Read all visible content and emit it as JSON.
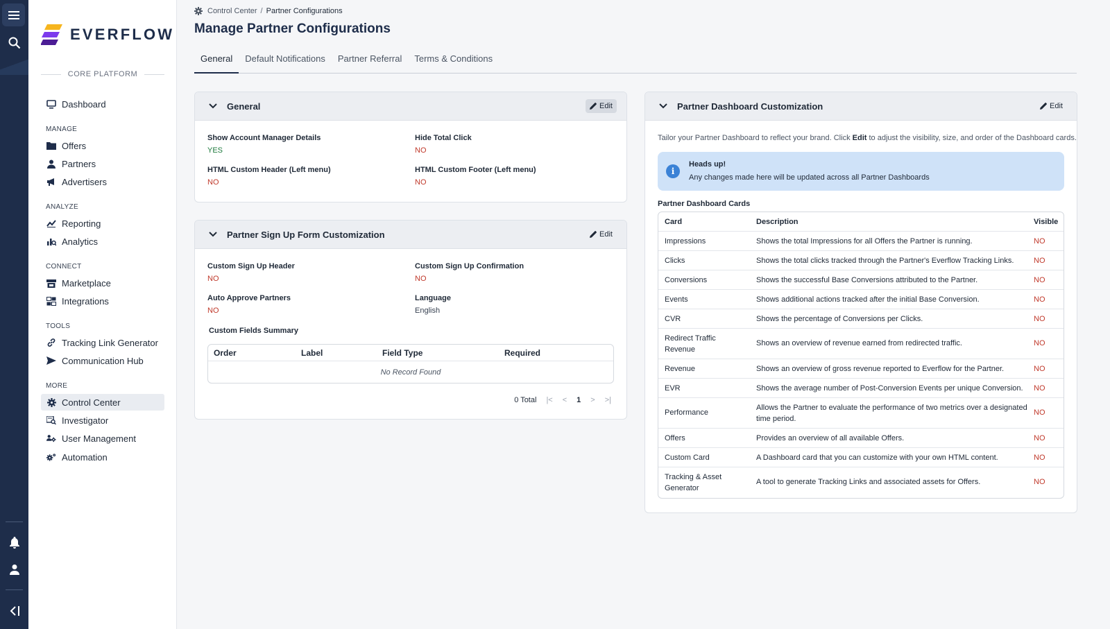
{
  "brand": {
    "name": "EVERFLOW",
    "platform": "CORE PLATFORM"
  },
  "nav": {
    "dashboard": "Dashboard",
    "sections": [
      {
        "title": "MANAGE",
        "items": [
          "Offers",
          "Partners",
          "Advertisers"
        ]
      },
      {
        "title": "ANALYZE",
        "items": [
          "Reporting",
          "Analytics"
        ]
      },
      {
        "title": "CONNECT",
        "items": [
          "Marketplace",
          "Integrations"
        ]
      },
      {
        "title": "TOOLS",
        "items": [
          "Tracking Link Generator",
          "Communication Hub"
        ]
      },
      {
        "title": "MORE",
        "items": [
          "Control Center",
          "Investigator",
          "User Management",
          "Automation"
        ]
      }
    ],
    "active": "Control Center"
  },
  "breadcrumb": {
    "parent": "Control Center",
    "separator": "/",
    "current": "Partner Configurations"
  },
  "page_title": "Manage Partner Configurations",
  "tabs": [
    "General",
    "Default Notifications",
    "Partner Referral",
    "Terms & Conditions"
  ],
  "general_card": {
    "title": "General",
    "edit": "Edit",
    "fields": [
      {
        "label": "Show Account Manager Details",
        "value": "YES"
      },
      {
        "label": "Hide Total Click",
        "value": "NO"
      },
      {
        "label": "HTML Custom Header (Left menu)",
        "value": "NO"
      },
      {
        "label": "HTML Custom Footer (Left menu)",
        "value": "NO"
      }
    ]
  },
  "signup_card": {
    "title": "Partner Sign Up Form Customization",
    "edit": "Edit",
    "fields": [
      {
        "label": "Custom Sign Up Header",
        "value": "NO"
      },
      {
        "label": "Custom Sign Up Confirmation",
        "value": "NO"
      },
      {
        "label": "Auto Approve Partners",
        "value": "NO"
      },
      {
        "label": "Language",
        "value": "English"
      }
    ],
    "custom_fields_title": "Custom Fields Summary",
    "columns": [
      "Order",
      "Label",
      "Field Type",
      "Required"
    ],
    "empty": "No Record Found",
    "pager": {
      "total": "0 Total",
      "first": "|<",
      "prev": "<",
      "page": "1",
      "next": ">",
      "last": ">|"
    }
  },
  "dashboard_card": {
    "title": "Partner Dashboard Customization",
    "edit": "Edit",
    "intro_pre": "Tailor your Partner Dashboard to reflect your brand. Click",
    "intro_bold": "Edit",
    "intro_post": "to adjust the visibility, size, and order of the Dashboard cards.",
    "alert_title": "Heads up!",
    "alert_body": "Any changes made here will be updated across all Partner Dashboards",
    "cards_title": "Partner Dashboard Cards",
    "columns": [
      "Card",
      "Description",
      "Visible"
    ],
    "rows": [
      {
        "card": "Impressions",
        "description": "Shows the total Impressions for all Offers the Partner is running.",
        "visible": "NO"
      },
      {
        "card": "Clicks",
        "description": "Shows the total clicks tracked through the Partner's Everflow Tracking Links.",
        "visible": "NO"
      },
      {
        "card": "Conversions",
        "description": "Shows the successful Base Conversions attributed to the Partner.",
        "visible": "NO"
      },
      {
        "card": "Events",
        "description": "Shows additional actions tracked after the initial Base Conversion.",
        "visible": "NO"
      },
      {
        "card": "CVR",
        "description": "Shows the percentage of Conversions per Clicks.",
        "visible": "NO"
      },
      {
        "card": "Redirect Traffic Revenue",
        "description": "Shows an overview of revenue earned from redirected traffic.",
        "visible": "NO"
      },
      {
        "card": "Revenue",
        "description": "Shows an overview of gross revenue reported to Everflow for the Partner.",
        "visible": "NO"
      },
      {
        "card": "EVR",
        "description": "Shows the average number of Post-Conversion Events per unique Conversion.",
        "visible": "NO"
      },
      {
        "card": "Performance",
        "description": "Allows the Partner to evaluate the performance of two metrics over a designated time period.",
        "visible": "NO"
      },
      {
        "card": "Offers",
        "description": "Provides an overview of all available Offers.",
        "visible": "NO"
      },
      {
        "card": "Custom Card",
        "description": "A Dashboard card that you can customize with your own HTML content.",
        "visible": "NO"
      },
      {
        "card": "Tracking & Asset Generator",
        "description": "A tool to generate Tracking Links and associated assets for Offers.",
        "visible": "NO"
      }
    ]
  },
  "colors": {
    "navy": "#1e2d4a",
    "no": "#c0392b",
    "yes": "#1e7a3d",
    "alert_bg": "#cfe2f8",
    "logo_yellow": "#f6b51e",
    "logo_purple": "#5b2fc9"
  },
  "icons": [
    "menu-icon",
    "search-icon",
    "bell-icon",
    "user-icon",
    "collapse-icon",
    "gear-icon",
    "pencil-icon",
    "chevron-down-icon",
    "info-icon"
  ]
}
